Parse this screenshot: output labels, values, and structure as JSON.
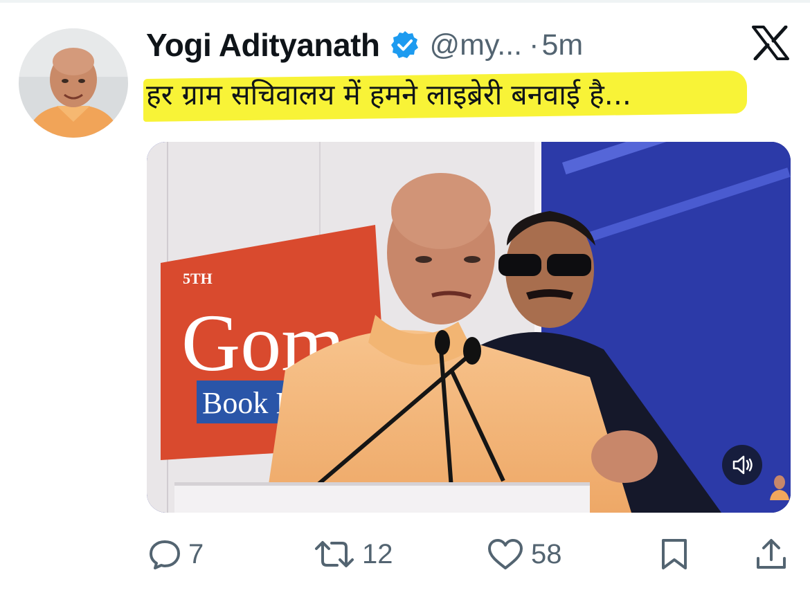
{
  "tweet": {
    "author_name": "Yogi Adityanath",
    "handle": "@my...",
    "separator": "·",
    "timestamp": "5m",
    "text": "हर ग्राम सचिवालय में हमने लाइब्रेरी बनवाई है..."
  },
  "media": {
    "banner_edition": "5TH",
    "banner_title": "Gom",
    "banner_subtitle": "Book F"
  },
  "actions": {
    "replies": "7",
    "reposts": "12",
    "likes": "58"
  },
  "icons": {
    "verified": "verified-badge-icon",
    "platform": "x-logo-icon",
    "reply": "reply-bubble-icon",
    "repost": "repost-arrows-icon",
    "like": "heart-icon",
    "bookmark": "bookmark-icon",
    "share": "share-upload-icon",
    "mute": "speaker-muted-icon"
  },
  "colors": {
    "verified": "#1d9bf0",
    "text": "#0f1419",
    "secondary": "#536471",
    "highlight": "#f8f337"
  }
}
